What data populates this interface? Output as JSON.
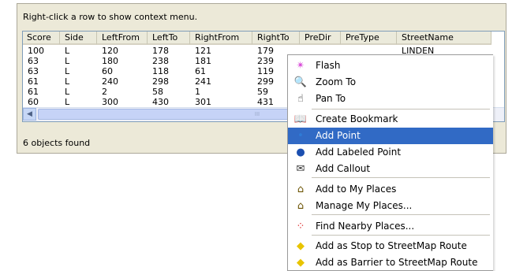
{
  "hint_text": "Right-click a row to show context menu.",
  "columns": [
    "Score",
    "Side",
    "LeftFrom",
    "LeftTo",
    "RightFrom",
    "RightTo",
    "PreDir",
    "PreType",
    "StreetName"
  ],
  "rows": [
    [
      "100",
      "L",
      "120",
      "178",
      "121",
      "179",
      "",
      "",
      "LINDEN"
    ],
    [
      "63",
      "L",
      "180",
      "238",
      "181",
      "239",
      "",
      "",
      ""
    ],
    [
      "63",
      "L",
      "60",
      "118",
      "61",
      "119",
      "",
      "",
      ""
    ],
    [
      "61",
      "L",
      "240",
      "298",
      "241",
      "299",
      "",
      "",
      ""
    ],
    [
      "61",
      "L",
      "2",
      "58",
      "1",
      "59",
      "",
      "",
      ""
    ],
    [
      "60",
      "L",
      "300",
      "430",
      "301",
      "431",
      "",
      "",
      ""
    ]
  ],
  "scroll_left_glyph": "◀",
  "scroll_thumb_grip": "III",
  "status_text": "6 objects found",
  "menu": [
    {
      "label": "Flash",
      "icon": "flash-icon",
      "glyph": "✴",
      "color": "#d84ad8"
    },
    {
      "label": "Zoom To",
      "icon": "zoom-in-icon",
      "glyph": "🔍",
      "color": "#222"
    },
    {
      "label": "Pan To",
      "icon": "hand-icon",
      "glyph": "☝",
      "color": "#222"
    },
    {
      "label": "Create Bookmark",
      "icon": "bookmark-icon",
      "glyph": "📖",
      "color": "#222"
    },
    {
      "label": "Add Point",
      "icon": "point-icon",
      "glyph": "•",
      "color": "#2e7bd6"
    },
    {
      "label": "Add Labeled Point",
      "icon": "labeled-point-icon",
      "glyph": "●",
      "color": "#1b4fb0"
    },
    {
      "label": "Add Callout",
      "icon": "callout-icon",
      "glyph": "✉",
      "color": "#333"
    },
    {
      "label": "Add to My Places",
      "icon": "add-place-icon",
      "glyph": "⌂",
      "color": "#6a5200"
    },
    {
      "label": "Manage My Places...",
      "icon": "manage-places-icon",
      "glyph": "⌂",
      "color": "#6a5200"
    },
    {
      "label": "Find Nearby Places...",
      "icon": "nearby-icon",
      "glyph": "⁘",
      "color": "#d22"
    },
    {
      "label": "Add as Stop to StreetMap Route",
      "icon": "route-stop-icon",
      "glyph": "◆",
      "color": "#e8c400"
    },
    {
      "label": "Add as Barrier to StreetMap Route",
      "icon": "route-barrier-icon",
      "glyph": "◆",
      "color": "#e8c400"
    }
  ]
}
